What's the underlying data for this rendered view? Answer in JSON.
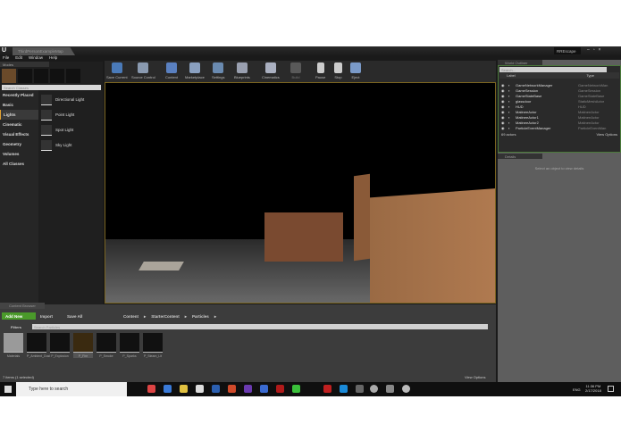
{
  "window": {
    "tab_title": "ThirdPersonExampleMap",
    "project": "RREscape"
  },
  "menu": [
    "File",
    "Edit",
    "Window",
    "Help"
  ],
  "modes": {
    "title": "Modes",
    "search_placeholder": "Search Classes",
    "categories": [
      "Recently Placed",
      "Basic",
      "Lights",
      "Cinematic",
      "Visual Effects",
      "Geometry",
      "Volumes",
      "All Classes"
    ],
    "selected": "Lights",
    "items": [
      "Directional Light",
      "Point Light",
      "Spot Light",
      "Sky Light"
    ]
  },
  "toolbar": [
    "Save Current",
    "Source Control",
    "Content",
    "Marketplace",
    "Settings",
    "Blueprints",
    "Cinematics",
    "Build",
    "Pause",
    "Stop",
    "Eject"
  ],
  "outliner": {
    "title": "World Outliner",
    "search_placeholder": "Search...",
    "col_label": "Label",
    "col_type": "Type",
    "rows": [
      [
        "GameNetworkManager",
        "GameNetworkMan"
      ],
      [
        "GameSession",
        "GameSession"
      ],
      [
        "GameStateBase",
        "GameStateBase"
      ],
      [
        "glassdoor",
        "StaticMeshActor"
      ],
      [
        "HUD",
        "HUD"
      ],
      [
        "MatineeActor",
        "MatineeActor"
      ],
      [
        "MatineeActor1",
        "MatineeActor"
      ],
      [
        "MatineeActor2",
        "MatineeActor"
      ],
      [
        "ParticleEventManager",
        "ParticleEventMan"
      ]
    ],
    "count": "69 actors",
    "view_options": "View Options"
  },
  "details": {
    "title": "Details",
    "empty": "Select an object to view details"
  },
  "content_browser": {
    "title": "Content Browser",
    "add_new": "Add New",
    "import": "Import",
    "save_all": "Save All",
    "path": [
      "Content",
      "StarterContent",
      "Particles"
    ],
    "filters": "Filters",
    "search_placeholder": "Search Particles",
    "assets": [
      "Materials",
      "P_Ambient_Dust",
      "P_Explosion",
      "P_Fire",
      "P_Smoke",
      "P_Sparks",
      "P_Steam_Lit"
    ],
    "status": "7 items (1 selected)",
    "view_options": "View Options"
  },
  "taskbar": {
    "search_placeholder": "Type here to search",
    "lang": "ENG",
    "time": "11:36 PM",
    "date": "2/17/2018"
  },
  "colors": {
    "accent": "#e0a030",
    "add_new": "#4a9a2a",
    "outliner_border": "#4a7a3a"
  }
}
